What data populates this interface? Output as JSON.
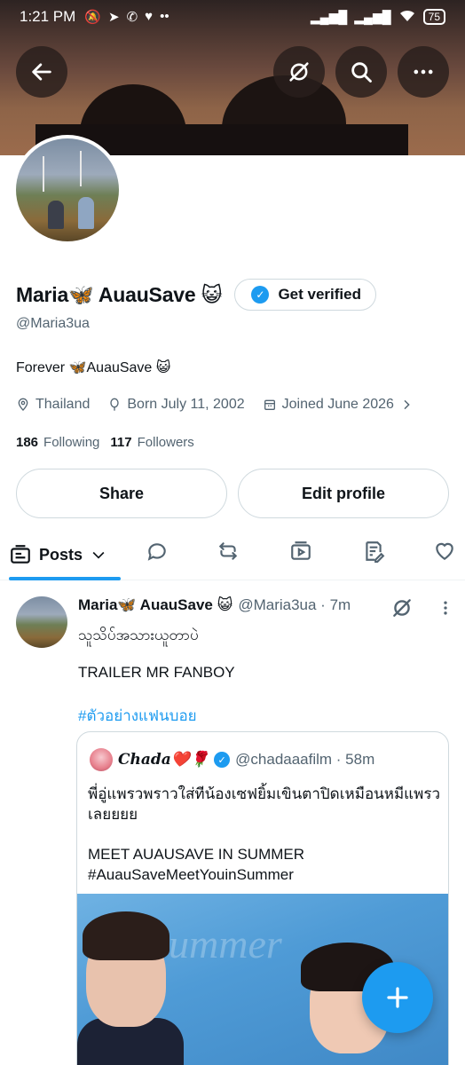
{
  "status_bar": {
    "time": "1:21 PM",
    "left_icons": [
      "muted-icon",
      "telegram-icon",
      "missed-call-icon",
      "heart-icon",
      "more-dots-icon"
    ],
    "right_icons": [
      "signal-icon",
      "signal-icon",
      "wifi-icon"
    ],
    "battery": "75"
  },
  "header": {
    "buttons": [
      "back-icon",
      "grok-icon",
      "search-icon",
      "more-icon"
    ]
  },
  "profile": {
    "name": "Maria🦋 AuauSave 😺",
    "verify_label": "Get verified",
    "handle": "@Maria3ua",
    "bio": "Forever 🦋AuauSave 😺",
    "location": "Thailand",
    "born": "Born July 11, 2002",
    "joined": "Joined June 2026",
    "following_count": "186",
    "following_label": "Following",
    "followers_count": "117",
    "followers_label": "Followers",
    "share_label": "Share",
    "edit_label": "Edit profile"
  },
  "tabs": {
    "posts_label": "Posts",
    "icons": [
      "replies-icon",
      "repost-icon",
      "media-icon",
      "articles-icon",
      "likes-icon"
    ]
  },
  "post": {
    "name": "Maria🦋 AuauSave 😺",
    "handle_time": "@Maria3ua · 7m",
    "text1": "သူသိပ်အသားယူတာပဲ",
    "text2": "TRAILER MR FANBOY",
    "hashtag": "#ตัวอย่างแฟนบอย",
    "quote": {
      "name": "𝑪𝒉𝒂𝒅𝒂❤️🌹",
      "handle_time": "@chadaaafilm · 58m",
      "text1": "พี่อู่แพรวพราวใส่ทีน้องเซฟยิ้มเขินตาปิดเหมือนหมีแพรวเลยยยย",
      "text2": "MEET AUAUSAVE IN SUMMER",
      "text3": "#AuauSaveMeetYouinSummer",
      "image_watermark": "Summer"
    }
  },
  "colors": {
    "accent": "#1d9bf0",
    "text_primary": "#0f1419",
    "text_secondary": "#536471",
    "border": "#cfd9de"
  }
}
